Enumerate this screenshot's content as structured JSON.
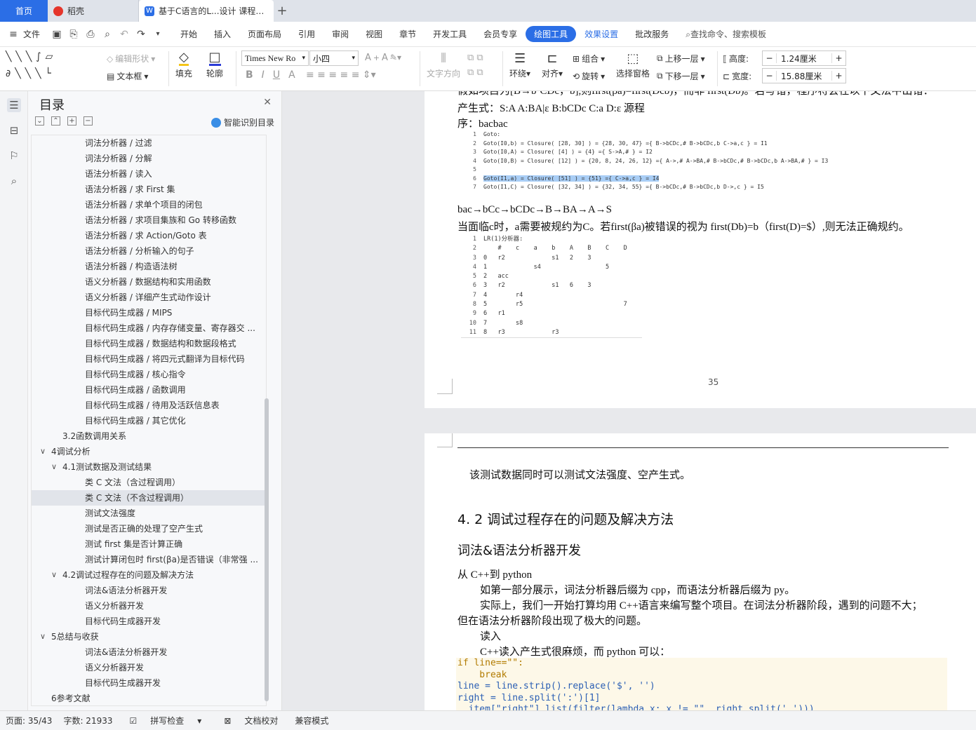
{
  "tabs": {
    "home": "首页",
    "daoke": "稻壳",
    "doc": "基于C语言的L...设计 课程论文",
    "add": "+"
  },
  "menu": {
    "file": "文件",
    "items": [
      "开始",
      "插入",
      "页面布局",
      "引用",
      "审阅",
      "视图",
      "章节",
      "开发工具",
      "会员专享"
    ],
    "active": "绘图工具",
    "effects": "效果设置",
    "batch": "批改服务",
    "search": "查找命令、搜索模板"
  },
  "toolbar": {
    "edit_shape": "编辑形状",
    "textbox": "文本框",
    "fill": "填充",
    "outline": "轮廓",
    "font_name": "Times New Ro",
    "font_size": "小四",
    "text_dir": "文字方向",
    "wrap": "环绕",
    "align": "对齐",
    "group": "组合",
    "rotate": "旋转",
    "select_pane": "选择窗格",
    "bring_up": "上移一层",
    "send_down": "下移一层",
    "height_label": "高度:",
    "height_value": "1.24厘米",
    "width_label": "宽度:",
    "width_value": "15.88厘米",
    "minus": "−",
    "plus": "+"
  },
  "nav": {
    "title": "目录",
    "smart": "智能识别目录",
    "items": [
      {
        "text": "词法分析器 / 过滤",
        "indent": 3
      },
      {
        "text": "词法分析器 / 分解",
        "indent": 3
      },
      {
        "text": "语法分析器 / 读入",
        "indent": 3
      },
      {
        "text": "语法分析器 / 求 First 集",
        "indent": 3
      },
      {
        "text": "语法分析器 / 求单个项目的闭包",
        "indent": 3
      },
      {
        "text": "语法分析器 / 求项目集族和 Go 转移函数",
        "indent": 3
      },
      {
        "text": "语法分析器 / 求 Action/Goto 表",
        "indent": 3
      },
      {
        "text": "语法分析器 / 分析输入的句子",
        "indent": 3
      },
      {
        "text": "语法分析器 / 构造语法树",
        "indent": 3
      },
      {
        "text": "语义分析器 / 数据结构和实用函数",
        "indent": 3
      },
      {
        "text": "语义分析器 / 详细产生式动作设计",
        "indent": 3
      },
      {
        "text": "目标代码生成器 / MIPS",
        "indent": 3
      },
      {
        "text": "目标代码生成器 / 内存存储变量、寄存器交 ...",
        "indent": 3
      },
      {
        "text": "目标代码生成器 / 数据结构和数据段格式",
        "indent": 3
      },
      {
        "text": "目标代码生成器 / 将四元式翻译为目标代码",
        "indent": 3
      },
      {
        "text": "目标代码生成器 / 核心指令",
        "indent": 3
      },
      {
        "text": "目标代码生成器 / 函数调用",
        "indent": 3
      },
      {
        "text": "目标代码生成器 / 待用及活跃信息表",
        "indent": 3
      },
      {
        "text": "目标代码生成器 / 其它优化",
        "indent": 3
      },
      {
        "text": "3.2函数调用关系",
        "indent": 2
      },
      {
        "text": "4调试分析",
        "indent": 1,
        "toggle": "∨"
      },
      {
        "text": "4.1测试数据及测试结果",
        "indent": 2,
        "toggle": "∨"
      },
      {
        "text": "类 C 文法（含过程调用）",
        "indent": 3
      },
      {
        "text": "类 C 文法（不含过程调用）",
        "indent": 3,
        "selected": true
      },
      {
        "text": "测试文法强度",
        "indent": 3
      },
      {
        "text": "测试是否正确的处理了空产生式",
        "indent": 3
      },
      {
        "text": "测试 first 集是否计算正确",
        "indent": 3
      },
      {
        "text": "测试计算闭包时 first(βa)是否错误（非常强 ...",
        "indent": 3
      },
      {
        "text": "4.2调试过程存在的问题及解决方法",
        "indent": 2,
        "toggle": "∨"
      },
      {
        "text": "词法&语法分析器开发",
        "indent": 3
      },
      {
        "text": "语义分析器开发",
        "indent": 3
      },
      {
        "text": "目标代码生成器开发",
        "indent": 3
      },
      {
        "text": "5总结与收获",
        "indent": 1,
        "toggle": "∨"
      },
      {
        "text": "词法&语法分析器开发",
        "indent": 3
      },
      {
        "text": "语义分析器开发",
        "indent": 3
      },
      {
        "text": "目标代码生成器开发",
        "indent": 3
      },
      {
        "text": "6参考文献",
        "indent": 1
      }
    ]
  },
  "page1": {
    "l0": "假如项目为[B→b·CDc，b],则first(βa)=first(Dcb)，而非 first(Db)。若写错，程序将会在以下文法中出错：",
    "l1": "产生式：S:A   A:BA|ε   B:bCDc   C:a   D:ε 源程",
    "l2": "序：bacbac",
    "goto": [
      "Goto:",
      "Goto(I0,b) = Closure( [28, 30] ) = {28, 30, 47} ={ B->bCDc,# B->bCDc,b C->a,c } = I1",
      "Goto(I0,A) = Closure( [4] ) = {4} ={ S->A,# } = I2",
      "Goto(I0,B) = Closure( [12] ) = {20, 8, 24, 26, 12} ={ A->,# A->BA,# B->bCDc,# B->bCDc,b A->BA,# } = I3",
      "",
      "Goto(I1,a) = Closure( [51] ) = {51} ={ C->a,c } = I4",
      "Goto(I1,C) = Closure( [32, 34] ) = {32, 34, 55} ={ B->bCDc,# B->bCDc,b D->,c } = I5"
    ],
    "l3": "bac→bCc→bCDc→B→BA→A→S",
    "l4": "当面临c时，a需要被规约为C。若first(βa)被错误的视为 first(Db)=b（first(D)=$）,则无法正确规约。",
    "table": [
      "LR(1)分析器:",
      "    #    c    a    b    A    B    C    D",
      "0   r2             s1   2    3",
      "1             s4                  5",
      "2   acc",
      "3   r2             s1   6    3",
      "4        r4",
      "5        r5                            7",
      "6   r1",
      "7        s8",
      "8   r3             r3"
    ],
    "page_no": "35"
  },
  "page2": {
    "p1": "该测试数据同时可以测试文法强度、空产生式。",
    "h1": "4. 2 调试过程存在的问题及解决方法",
    "h2": "词法&语法分析器开发",
    "l1": "从 C++到 python",
    "l2": "如第一部分展示，词法分析器后缀为 cpp，而语法分析器后缀为 py。",
    "l3": "实际上，我们一开始打算均用 C++语言来编写整个项目。在词法分析器阶段，遇到的问题不大；",
    "l4": "但在语法分析器阶段出现了极大的问题。",
    "l5": "读入",
    "l6": "C++读入产生式很麻烦，而 python 可以：",
    "code": [
      "if line==\"\":",
      "    break",
      "line = line.strip().replace('$', '')",
      "right = line.split(':')[1]",
      "  item[\"right\"] list(filter(lambda x: x != \"\", right.split(' ')))"
    ]
  },
  "status": {
    "page": "页面: 35/43",
    "words": "字数: 21933",
    "spell": "拼写检查",
    "proof": "文档校对",
    "compat": "兼容模式"
  },
  "colors": {
    "accent": "#2b6ee6",
    "selected_toc": "#e1e4ea"
  }
}
